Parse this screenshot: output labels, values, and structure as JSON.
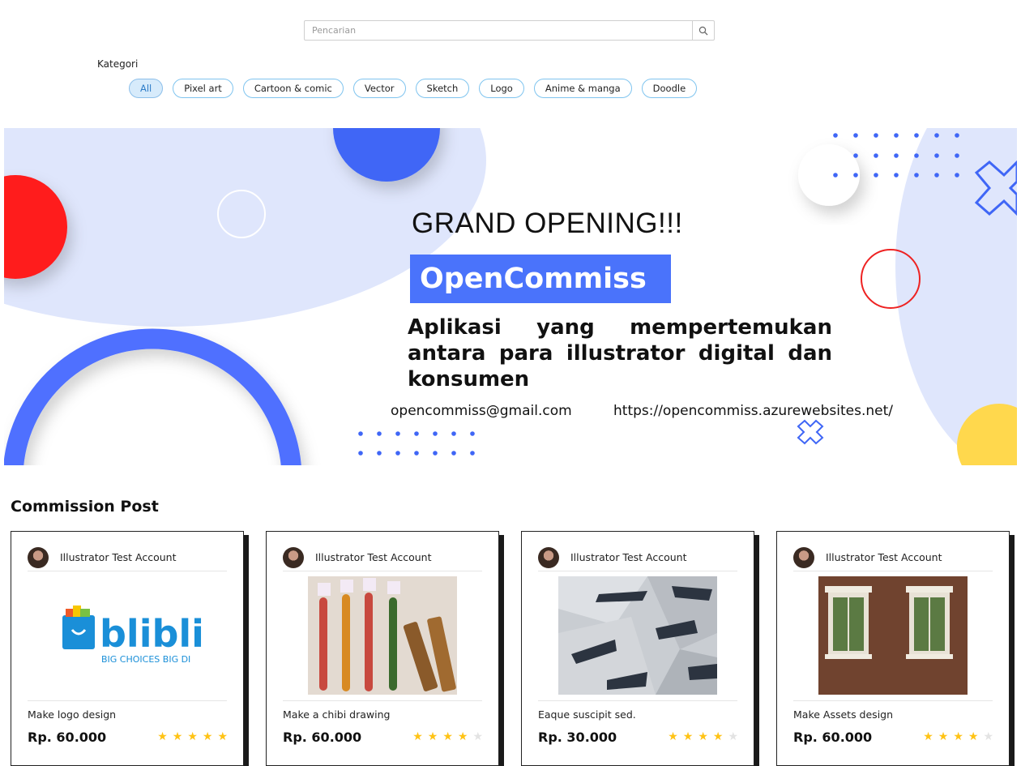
{
  "search": {
    "placeholder": "Pencarian",
    "icon": "search-icon"
  },
  "categories": {
    "label": "Kategori",
    "items": [
      "All",
      "Pixel art",
      "Cartoon & comic",
      "Vector",
      "Sketch",
      "Logo",
      "Anime & manga",
      "Doodle"
    ],
    "selected": "All"
  },
  "banner": {
    "headline": "GRAND OPENING!!!",
    "brand": "OpenCommiss",
    "description": "Aplikasi yang mempertemukan antara para illustrator digital dan konsumen",
    "email": "opencommiss@gmail.com",
    "url": "https://opencommiss.azurewebsites.net/",
    "colors": {
      "blue": "#4a73fb",
      "red": "#ff1a1a",
      "yellow": "#ffd84d",
      "pale": "#dfe6fc"
    }
  },
  "section": {
    "title": "Commission Post"
  },
  "posts": [
    {
      "author": "Illustrator Test Account",
      "title": "Make logo design",
      "price": "Rp. 60.000",
      "rating": 5,
      "image": "blibli-logo",
      "logo_text": "blibli",
      "tagline": "BIG CHOICES  BIG DI"
    },
    {
      "author": "Illustrator Test Account",
      "title": "Make a chibi drawing",
      "price": "Rp. 60.000",
      "rating": 4,
      "image": "keychain-photo"
    },
    {
      "author": "Illustrator Test Account",
      "title": "Eaque suscipit sed.",
      "price": "Rp. 30.000",
      "rating": 4,
      "image": "architecture-photo"
    },
    {
      "author": "Illustrator Test Account",
      "title": "Make Assets design",
      "price": "Rp. 60.000",
      "rating": 4,
      "image": "windows-photo"
    }
  ]
}
